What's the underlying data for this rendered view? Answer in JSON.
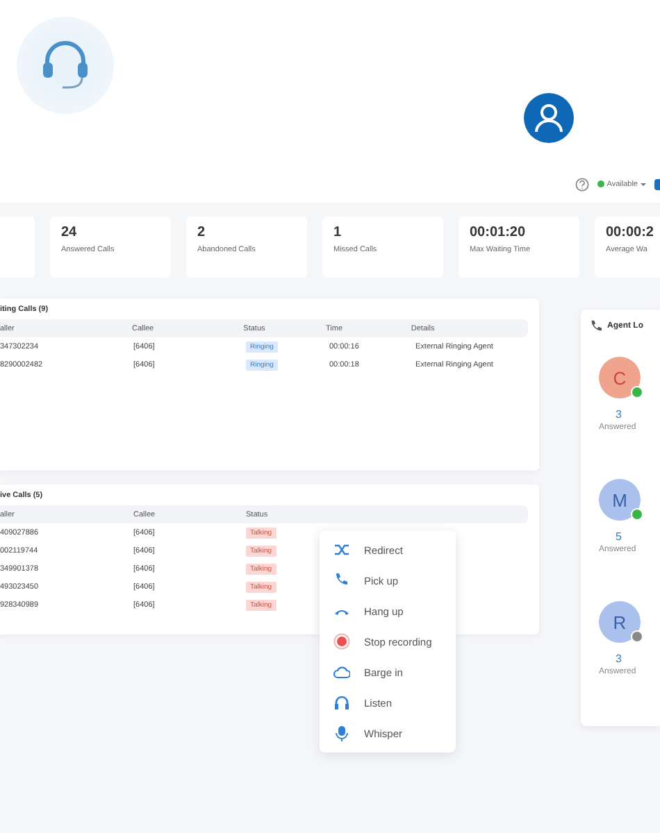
{
  "toolbar": {
    "status": "Available",
    "online": true
  },
  "stats": [
    {
      "value": "24",
      "label": "Answered Calls"
    },
    {
      "value": "2",
      "label": "Abandoned Calls"
    },
    {
      "value": "1",
      "label": "Missed Calls"
    },
    {
      "value": "00:01:20",
      "label": "Max Waiting Time"
    },
    {
      "value": "00:00:2",
      "label": "Average Wa"
    }
  ],
  "waiting_calls": {
    "title": "iting Calls (9)",
    "columns": [
      "aller",
      "Callee",
      "Status",
      "Time",
      "Details"
    ],
    "rows": [
      {
        "caller": "347302234",
        "callee": "[6406]",
        "status": "Ringing",
        "kind": "ringing",
        "time": "00:00:16",
        "details": "External Ringing Agent"
      },
      {
        "caller": "8290002482",
        "callee": "[6406]",
        "status": "Ringing",
        "kind": "ringing",
        "time": "00:00:18",
        "details": "External Ringing Agent"
      }
    ]
  },
  "active_calls": {
    "title": "ive Calls (5)",
    "columns": [
      "aller",
      "Callee",
      "Status"
    ],
    "rows": [
      {
        "caller": "409027886",
        "callee": "[6406]",
        "status": "Talking",
        "kind": "talking"
      },
      {
        "caller": "002119744",
        "callee": "[6406]",
        "status": "Talking",
        "kind": "talking"
      },
      {
        "caller": "349901378",
        "callee": "[6406]",
        "status": "Talking",
        "kind": "talking"
      },
      {
        "caller": "493023450",
        "callee": "[6406]",
        "status": "Talking",
        "kind": "talking"
      },
      {
        "caller": "928340989",
        "callee": "[6406]",
        "status": "Talking",
        "kind": "talking"
      }
    ]
  },
  "context_menu": [
    {
      "label": "Redirect",
      "kind": "redirect"
    },
    {
      "label": "Pick up",
      "kind": "pickup"
    },
    {
      "label": "Hang up",
      "kind": "hangup"
    },
    {
      "label": "Stop recording",
      "kind": "record"
    },
    {
      "label": "Barge in",
      "kind": "barge"
    },
    {
      "label": "Listen",
      "kind": "listen"
    },
    {
      "label": "Whisper",
      "kind": "whisper"
    }
  ],
  "agent_panel": {
    "title": "Agent Lo",
    "agents": [
      {
        "initial": "C",
        "color": "#f0a48e",
        "count": "3",
        "label": "Answered",
        "online": true
      },
      {
        "initial": "M",
        "color": "#a9c1ec",
        "count": "5",
        "label": "Answered",
        "online": true
      },
      {
        "initial": "R",
        "color": "#a9c1ec",
        "count": "3",
        "label": "Answered",
        "online": false
      }
    ]
  }
}
